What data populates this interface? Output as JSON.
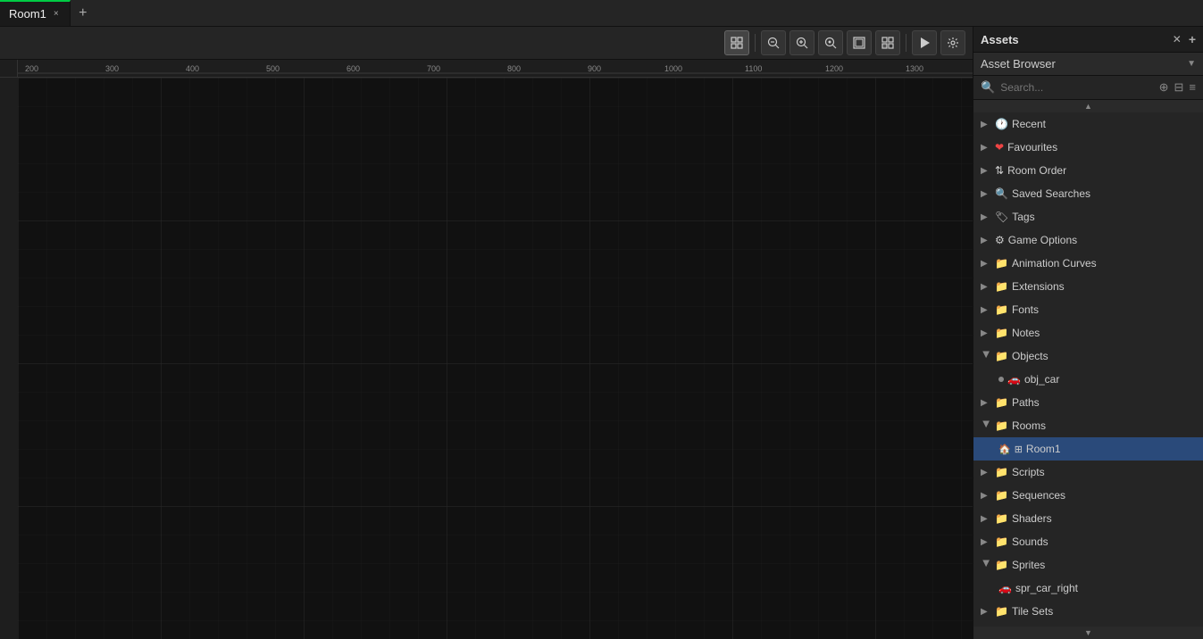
{
  "tab": {
    "label": "Room1",
    "close_label": "×",
    "add_label": "+"
  },
  "toolbar": {
    "buttons": [
      {
        "id": "grid",
        "icon": "⊞",
        "title": "Grid"
      },
      {
        "id": "zoom-out",
        "icon": "🔍-",
        "title": "Zoom Out"
      },
      {
        "id": "zoom-in",
        "icon": "🔍+",
        "title": "Zoom In"
      },
      {
        "id": "zoom-reset",
        "icon": "⊙",
        "title": "Reset Zoom"
      },
      {
        "id": "fit",
        "icon": "⛶",
        "title": "Fit"
      },
      {
        "id": "snap",
        "icon": "▣",
        "title": "Snap"
      },
      {
        "id": "play",
        "icon": "▶",
        "title": "Play"
      },
      {
        "id": "settings",
        "icon": "⚙",
        "title": "Settings"
      }
    ]
  },
  "ruler": {
    "ticks": [
      "200",
      "300",
      "400",
      "500",
      "600",
      "700",
      "800",
      "900",
      "1000",
      "1100",
      "1200",
      "1300"
    ]
  },
  "assets": {
    "panel_title": "Assets",
    "close_icon": "✕",
    "add_icon": "+",
    "dropdown_label": "Asset Browser",
    "dropdown_arrow": "▼",
    "search_placeholder": "Search...",
    "tree": [
      {
        "id": "recent",
        "label": "Recent",
        "indent": 0,
        "arrow": "▶",
        "icon": "🕐",
        "type": "expandable"
      },
      {
        "id": "favourites",
        "label": "Favourites",
        "indent": 0,
        "arrow": "▶",
        "icon": "❤",
        "type": "expandable"
      },
      {
        "id": "room-order",
        "label": "Room Order",
        "indent": 0,
        "arrow": "▶",
        "icon": "⇅",
        "type": "expandable"
      },
      {
        "id": "saved-searches",
        "label": "Saved Searches",
        "indent": 0,
        "arrow": "▶",
        "icon": "🔍",
        "type": "expandable"
      },
      {
        "id": "tags",
        "label": "Tags",
        "indent": 0,
        "arrow": "▶",
        "icon": "🏷",
        "type": "expandable"
      },
      {
        "id": "game-options",
        "label": "Game Options",
        "indent": 0,
        "arrow": "▶",
        "icon": "⚙",
        "type": "expandable"
      },
      {
        "id": "animation-curves",
        "label": "Animation Curves",
        "indent": 0,
        "arrow": "▶",
        "icon": "📁",
        "type": "folder"
      },
      {
        "id": "extensions",
        "label": "Extensions",
        "indent": 0,
        "arrow": "▶",
        "icon": "📁",
        "type": "folder"
      },
      {
        "id": "fonts",
        "label": "Fonts",
        "indent": 0,
        "arrow": "▶",
        "icon": "📁",
        "type": "folder"
      },
      {
        "id": "notes",
        "label": "Notes",
        "indent": 0,
        "arrow": "▶",
        "icon": "📁",
        "type": "folder"
      },
      {
        "id": "objects",
        "label": "Objects",
        "indent": 0,
        "arrow": "▼",
        "icon": "📁",
        "type": "folder-open"
      },
      {
        "id": "obj-car",
        "label": "obj_car",
        "indent": 1,
        "icon": "🚗",
        "type": "asset",
        "has_dot": true
      },
      {
        "id": "paths",
        "label": "Paths",
        "indent": 0,
        "arrow": "▶",
        "icon": "📁",
        "type": "folder"
      },
      {
        "id": "rooms",
        "label": "Rooms",
        "indent": 0,
        "arrow": "▼",
        "icon": "📁",
        "type": "folder-open"
      },
      {
        "id": "room1",
        "label": "Room1",
        "indent": 1,
        "icon": "🏠",
        "type": "asset",
        "selected": true
      },
      {
        "id": "scripts",
        "label": "Scripts",
        "indent": 0,
        "arrow": "▶",
        "icon": "📁",
        "type": "folder"
      },
      {
        "id": "sequences",
        "label": "Sequences",
        "indent": 0,
        "arrow": "▶",
        "icon": "📁",
        "type": "folder"
      },
      {
        "id": "shaders",
        "label": "Shaders",
        "indent": 0,
        "arrow": "▶",
        "icon": "📁",
        "type": "folder"
      },
      {
        "id": "sounds",
        "label": "Sounds",
        "indent": 0,
        "arrow": "▶",
        "icon": "📁",
        "type": "folder"
      },
      {
        "id": "sprites",
        "label": "Sprites",
        "indent": 0,
        "arrow": "▼",
        "icon": "📁",
        "type": "folder-open"
      },
      {
        "id": "spr-car-right",
        "label": "spr_car_right",
        "indent": 1,
        "icon": "🖼",
        "type": "asset"
      },
      {
        "id": "tile-sets",
        "label": "Tile Sets",
        "indent": 0,
        "arrow": "▶",
        "icon": "📁",
        "type": "folder"
      }
    ]
  }
}
